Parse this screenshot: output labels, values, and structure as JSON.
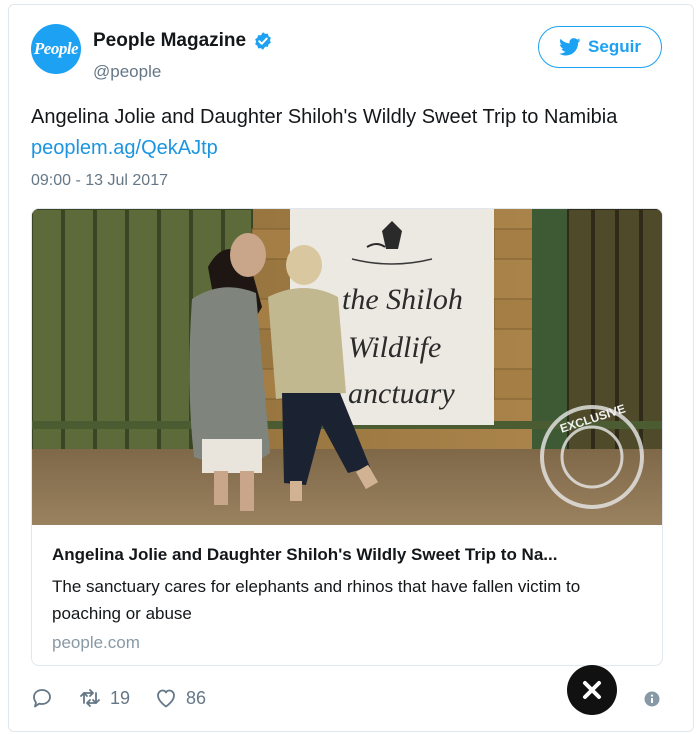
{
  "author": {
    "avatar_text": "People",
    "display_name": "People Magazine",
    "handle": "@people",
    "verified_icon": "verified-badge-icon"
  },
  "follow_button": {
    "label": "Seguir",
    "icon": "twitter-bird-icon"
  },
  "tweet": {
    "text": "Angelina Jolie and Daughter Shiloh's Wildly Sweet Trip to Namibia",
    "link": "peoplem.ag/QekAJtp",
    "timestamp": "09:00 - 13 Jul 2017"
  },
  "link_card": {
    "image_sign_text": [
      "the Shiloh",
      "Wildlife",
      "anctuary"
    ],
    "watermark_text": "EXCLUSIVE",
    "title": "Angelina Jolie and Daughter Shiloh's Wildly Sweet Trip to Na...",
    "description": "The sanctuary cares for elephants and rhinos that have fallen victim to poaching or abuse",
    "domain": "people.com"
  },
  "actions": {
    "reply_icon": "reply-icon",
    "retweet_icon": "retweet-icon",
    "retweet_count": "19",
    "like_icon": "heart-icon",
    "like_count": "86"
  },
  "colors": {
    "accent": "#1da1f2",
    "link": "#1b95e0",
    "secondary_text": "#657786"
  }
}
